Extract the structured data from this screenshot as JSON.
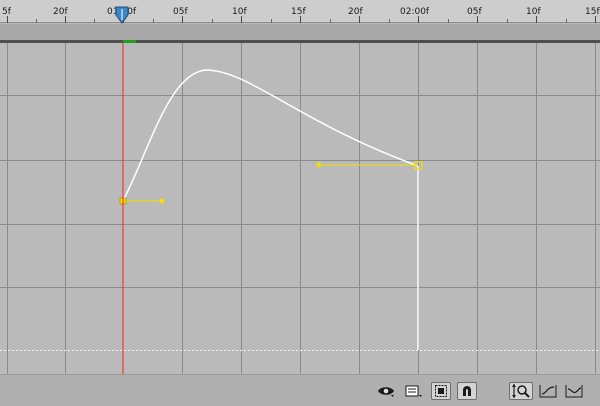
{
  "ruler": {
    "labels": [
      "5f",
      "20f",
      "01:00f",
      "05f",
      "10f",
      "15f",
      "20f",
      "02:00f",
      "05f",
      "10f",
      "15f"
    ]
  },
  "playhead": {
    "color": "#ff2020",
    "handle_color": "#3d86c8"
  },
  "work_area": {
    "marker_color": "#1fa01f"
  },
  "graph": {
    "curve_color": "#ffffff",
    "handle_color": "#f2e000",
    "keyframes": [
      "first-keyframe",
      "second-keyframe"
    ]
  },
  "toolbar": {
    "icons": [
      "eye-icon",
      "graph-type-icon",
      "show-transform-box-icon",
      "snap-icon",
      "fit-to-view-icon",
      "fit-selection-icon",
      "fit-all-icon"
    ]
  }
}
